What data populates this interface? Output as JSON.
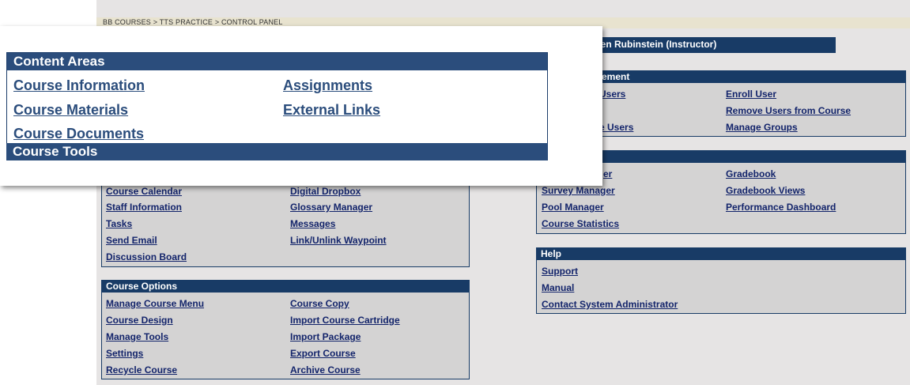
{
  "breadcrumb": "BB COURSES > TTS PRACTICE > CONTROL PANEL",
  "user_header": "ren Rubinstein (Instructor)",
  "content_areas": {
    "title": "Content Areas",
    "links": [
      "Course Information",
      "Assignments",
      "Course Materials",
      "External Links",
      "Course Documents"
    ]
  },
  "course_tools": {
    "title": "Course Tools",
    "links": [
      "Course Calendar",
      "Digital Dropbox",
      "Staff Information",
      "Glossary Manager",
      "Tasks",
      "Messages",
      "Send Email",
      "Link/Unlink Waypoint",
      "Discussion Board"
    ]
  },
  "course_options": {
    "title": "Course Options",
    "links": [
      "Manage Course Menu",
      "Course Copy",
      "Course Design",
      "Import Course Cartridge",
      "Manage Tools",
      "Import Package",
      "Settings",
      "Export Course",
      "Recycle Course",
      "Archive Course"
    ]
  },
  "user_management": {
    "title": "ement",
    "links": [
      "Users",
      "Enroll User",
      "Remove Users from Course",
      "e Users",
      "Manage Groups"
    ]
  },
  "assessment": {
    "title": "",
    "links": [
      "er",
      "Gradebook",
      "Survey Manager",
      "Gradebook Views",
      "Pool Manager",
      "Performance Dashboard",
      "Course Statistics"
    ]
  },
  "help": {
    "title": "Help",
    "links": [
      "Support",
      "Manual",
      "Contact System Administrator"
    ]
  },
  "colors": {
    "header_dark": "#183b66",
    "header_front": "#2b4d7c",
    "link": "#13246b",
    "panel_bg": "#d4d3d3"
  }
}
